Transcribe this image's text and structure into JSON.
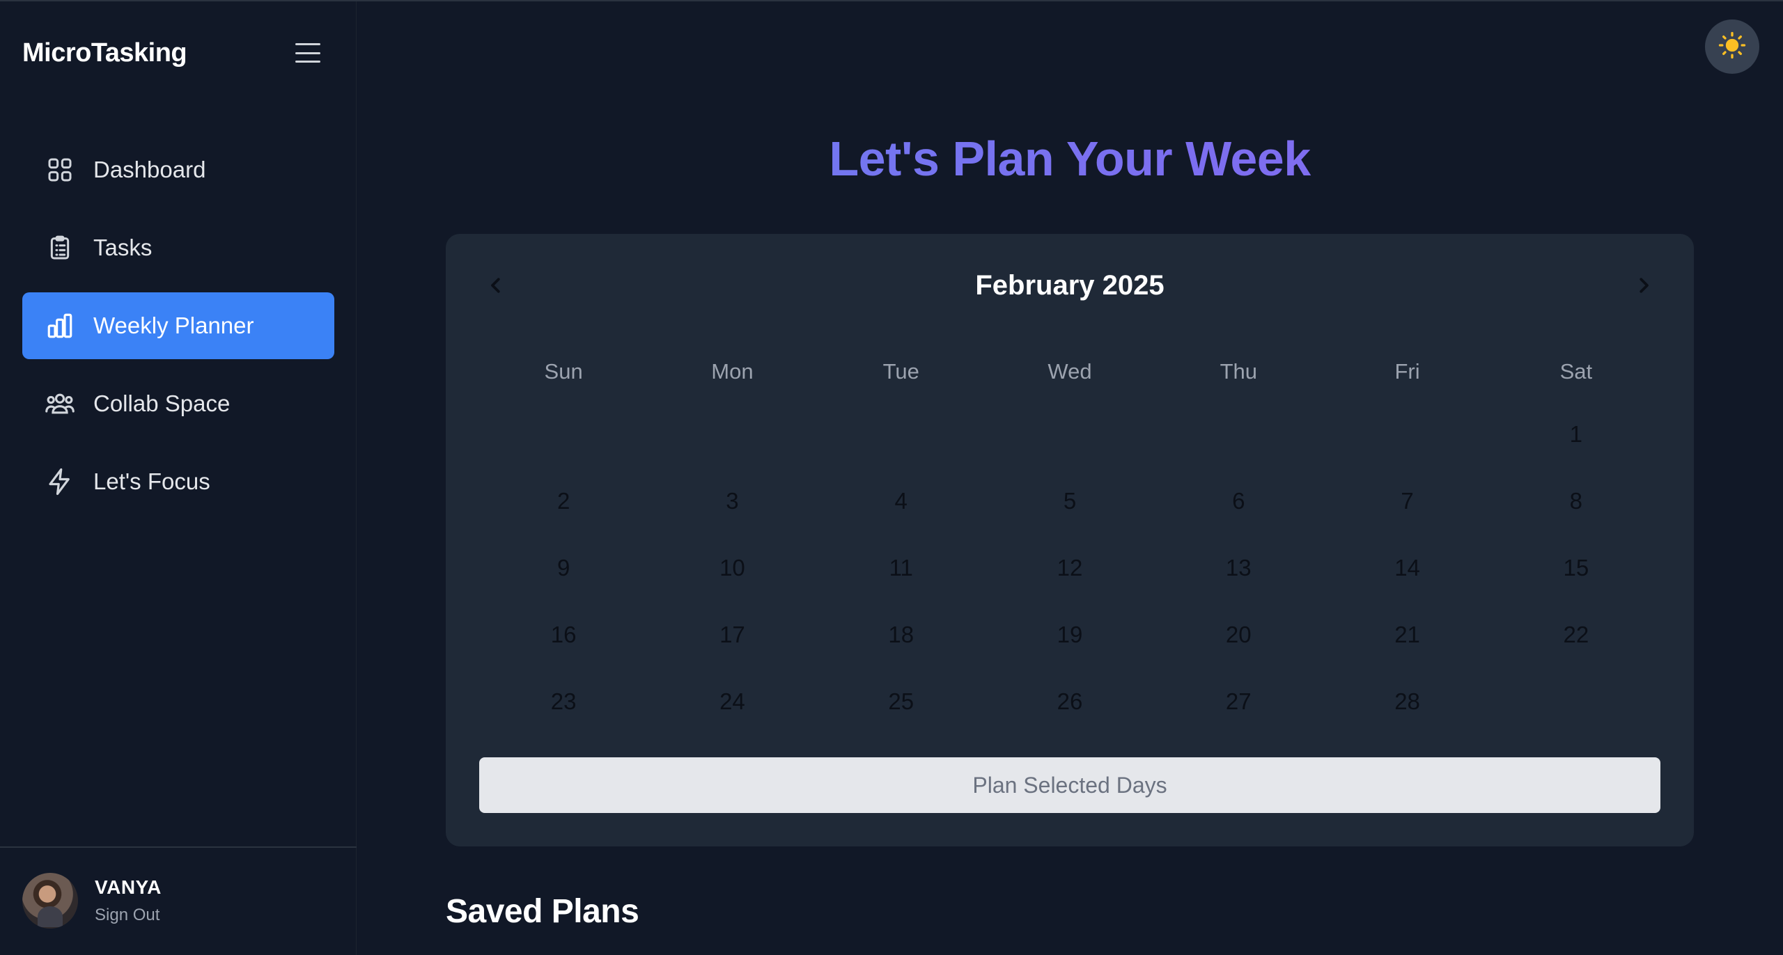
{
  "app": {
    "brand": "MicroTasking"
  },
  "sidebar": {
    "items": [
      {
        "label": "Dashboard",
        "icon": "grid-icon",
        "active": false
      },
      {
        "label": "Tasks",
        "icon": "clipboard-icon",
        "active": false
      },
      {
        "label": "Weekly Planner",
        "icon": "bar-chart-icon",
        "active": true
      },
      {
        "label": "Collab Space",
        "icon": "users-icon",
        "active": false
      },
      {
        "label": "Let's Focus",
        "icon": "lightning-icon",
        "active": false
      }
    ]
  },
  "user": {
    "name": "VANYA",
    "sign_out": "Sign Out"
  },
  "main": {
    "title": "Let's Plan Your Week",
    "calendar": {
      "month_label": "February 2025",
      "weekdays": [
        "Sun",
        "Mon",
        "Tue",
        "Wed",
        "Thu",
        "Fri",
        "Sat"
      ],
      "leading_blanks": 6,
      "days_in_month": 28
    },
    "plan_button": "Plan Selected Days",
    "saved_plans_title": "Saved Plans"
  },
  "colors": {
    "background": "#111827",
    "card": "#1f2937",
    "accent": "#3b82f6",
    "title_gradient_start": "#6b7ff0",
    "title_gradient_end": "#8b6cf0",
    "sun": "#fbbf24"
  }
}
